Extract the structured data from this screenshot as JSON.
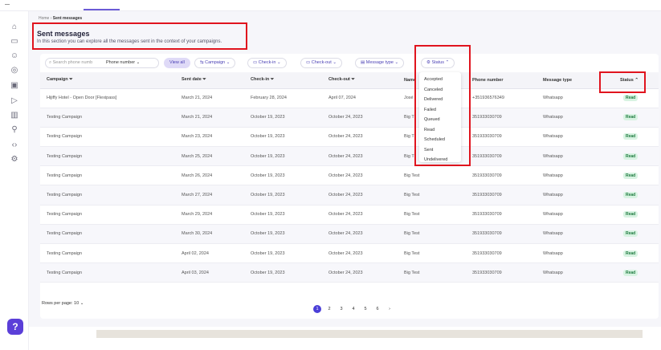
{
  "breadcrumb": {
    "home": "Home",
    "current": "Sent messages"
  },
  "page": {
    "title": "Sent messages",
    "description": "In this section you can explore all the messages sent in the context of your campaigns."
  },
  "filters": {
    "search_placeholder": "Search phone numb",
    "search_field": "Phone number",
    "all": "View all",
    "campaign": "Campaign",
    "checkin": "Check-in",
    "checkout": "Check-out",
    "message_type": "Message type",
    "status": "Status"
  },
  "status_options": [
    "Accepted",
    "Canceled",
    "Delivered",
    "Failed",
    "Queued",
    "Read",
    "Scheduled",
    "Sent",
    "Undelivered"
  ],
  "columns": [
    "Campaign",
    "Sent date",
    "Check-in",
    "Check-out",
    "Name",
    "Phone number",
    "Message type",
    "Status"
  ],
  "rows": [
    {
      "campaign": "Hijiffy Hotel - Open Door [Flexipass]",
      "sent": "March 21, 2024",
      "checkin": "February 28, 2024",
      "checkout": "April 07, 2024",
      "name": "José",
      "phone": "+351936576349",
      "type": "Whatsapp",
      "status": "Read"
    },
    {
      "campaign": "Testing Campaign",
      "sent": "March 21, 2024",
      "checkin": "October 19, 2023",
      "checkout": "October 24, 2023",
      "name": "Big T",
      "phone": "351933030709",
      "type": "Whatsapp",
      "status": "Read"
    },
    {
      "campaign": "Testing Campaign",
      "sent": "March 23, 2024",
      "checkin": "October 19, 2023",
      "checkout": "October 24, 2023",
      "name": "Big T",
      "phone": "351933030709",
      "type": "Whatsapp",
      "status": "Read"
    },
    {
      "campaign": "Testing Campaign",
      "sent": "March 25, 2024",
      "checkin": "October 19, 2023",
      "checkout": "October 24, 2023",
      "name": "Big T",
      "phone": "351933030709",
      "type": "Whatsapp",
      "status": "Read"
    },
    {
      "campaign": "Testing Campaign",
      "sent": "March 26, 2024",
      "checkin": "October 19, 2023",
      "checkout": "October 24, 2023",
      "name": "Big Test",
      "phone": "351933030709",
      "type": "Whatsapp",
      "status": "Read"
    },
    {
      "campaign": "Testing Campaign",
      "sent": "March 27, 2024",
      "checkin": "October 19, 2023",
      "checkout": "October 24, 2023",
      "name": "Big Test",
      "phone": "351933030709",
      "type": "Whatsapp",
      "status": "Read"
    },
    {
      "campaign": "Testing Campaign",
      "sent": "March 29, 2024",
      "checkin": "October 19, 2023",
      "checkout": "October 24, 2023",
      "name": "Big Test",
      "phone": "351933030709",
      "type": "Whatsapp",
      "status": "Read"
    },
    {
      "campaign": "Testing Campaign",
      "sent": "March 30, 2024",
      "checkin": "October 19, 2023",
      "checkout": "October 24, 2023",
      "name": "Big Test",
      "phone": "351933030709",
      "type": "Whatsapp",
      "status": "Read"
    },
    {
      "campaign": "Testing Campaign",
      "sent": "April 02, 2024",
      "checkin": "October 19, 2023",
      "checkout": "October 24, 2023",
      "name": "Big Test",
      "phone": "351933030709",
      "type": "Whatsapp",
      "status": "Read"
    },
    {
      "campaign": "Testing Campaign",
      "sent": "April 03, 2024",
      "checkin": "October 19, 2023",
      "checkout": "October 24, 2023",
      "name": "Big Test",
      "phone": "351933030709",
      "type": "Whatsapp",
      "status": "Read"
    }
  ],
  "footer": {
    "rows_per_page": "Rows per page: 10",
    "pages": [
      "1",
      "2",
      "3",
      "4",
      "5",
      "6"
    ],
    "next": "›"
  },
  "colors": {
    "accent": "#5b3fd8",
    "highlight": "#e0141e",
    "badge_bg": "#d8f3e2"
  }
}
